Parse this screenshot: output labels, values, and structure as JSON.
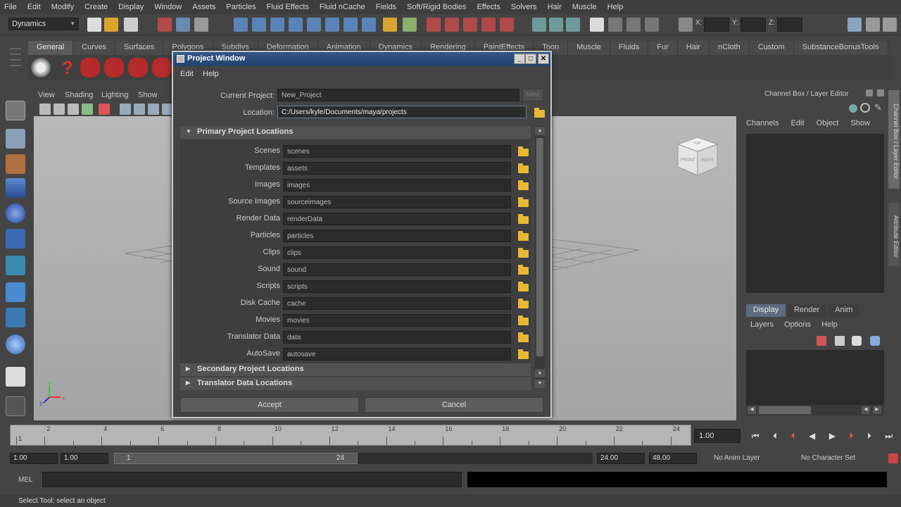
{
  "menu": [
    "File",
    "Edit",
    "Modify",
    "Create",
    "Display",
    "Window",
    "Assets",
    "Particles",
    "Fluid Effects",
    "Fluid nCache",
    "Fields",
    "Soft/Rigid Bodies",
    "Effects",
    "Solvers",
    "Hair",
    "Muscle",
    "Help"
  ],
  "status_line": {
    "mode": "Dynamics",
    "x_label": "X:",
    "y_label": "Y:",
    "z_label": "Z:"
  },
  "shelf_tabs": [
    "General",
    "Curves",
    "Surfaces",
    "Polygons",
    "Subdivs",
    "Deformation",
    "Animation",
    "Dynamics",
    "Rendering",
    "PaintEffects",
    "Toon",
    "Muscle",
    "Fluids",
    "Fur",
    "Hair",
    "nCloth",
    "Custom",
    "SubstanceBonusTools"
  ],
  "viewport_menu": [
    "View",
    "Shading",
    "Lighting",
    "Show"
  ],
  "viewcube": {
    "front": "FRONT",
    "right": "RIGHT",
    "top": "TOP"
  },
  "right_panel": {
    "title": "Channel Box / Layer Editor",
    "menu": [
      "Channels",
      "Edit",
      "Object",
      "Show"
    ],
    "tabs": [
      "Display",
      "Render",
      "Anim"
    ],
    "layer_menu": [
      "Layers",
      "Options",
      "Help"
    ],
    "vertical_tabs": [
      "Channel Box / Layer Editor",
      "Attribute Editor"
    ]
  },
  "timeline": {
    "ticks": [
      1,
      2,
      4,
      6,
      8,
      10,
      12,
      14,
      16,
      18,
      20,
      22,
      24
    ],
    "current_frame": "1.00"
  },
  "range": {
    "start": "1.00",
    "playback_start": "1.00",
    "slider_start": "1",
    "slider_end": "24",
    "playback_end": "24.00",
    "end": "48.00",
    "anim_layer": "No Anim Layer",
    "character_set": "No Character Set"
  },
  "command_line": {
    "label": "MEL"
  },
  "help_line": "Select Tool: select an object",
  "dialog": {
    "title": "Project Window",
    "menu": [
      "Edit",
      "Help"
    ],
    "current_project_label": "Current Project:",
    "current_project": "New_Project",
    "new_label": "New",
    "location_label": "Location:",
    "location": "C:/Users/kyle/Documents/maya/projects",
    "primary_header": "Primary Project Locations",
    "secondary_header": "Secondary Project Locations",
    "translator_header": "Translator Data Locations",
    "locations": [
      {
        "label": "Scenes",
        "value": "scenes"
      },
      {
        "label": "Templates",
        "value": "assets"
      },
      {
        "label": "Images",
        "value": "images"
      },
      {
        "label": "Source Images",
        "value": "sourceimages"
      },
      {
        "label": "Render Data",
        "value": "renderData"
      },
      {
        "label": "Particles",
        "value": "particles"
      },
      {
        "label": "Clips",
        "value": "clips"
      },
      {
        "label": "Sound",
        "value": "sound"
      },
      {
        "label": "Scripts",
        "value": "scripts"
      },
      {
        "label": "Disk Cache",
        "value": "cache"
      },
      {
        "label": "Movies",
        "value": "movies"
      },
      {
        "label": "Translator Data",
        "value": "data"
      },
      {
        "label": "AutoSave",
        "value": "autosave"
      }
    ],
    "accept": "Accept",
    "cancel": "Cancel"
  }
}
